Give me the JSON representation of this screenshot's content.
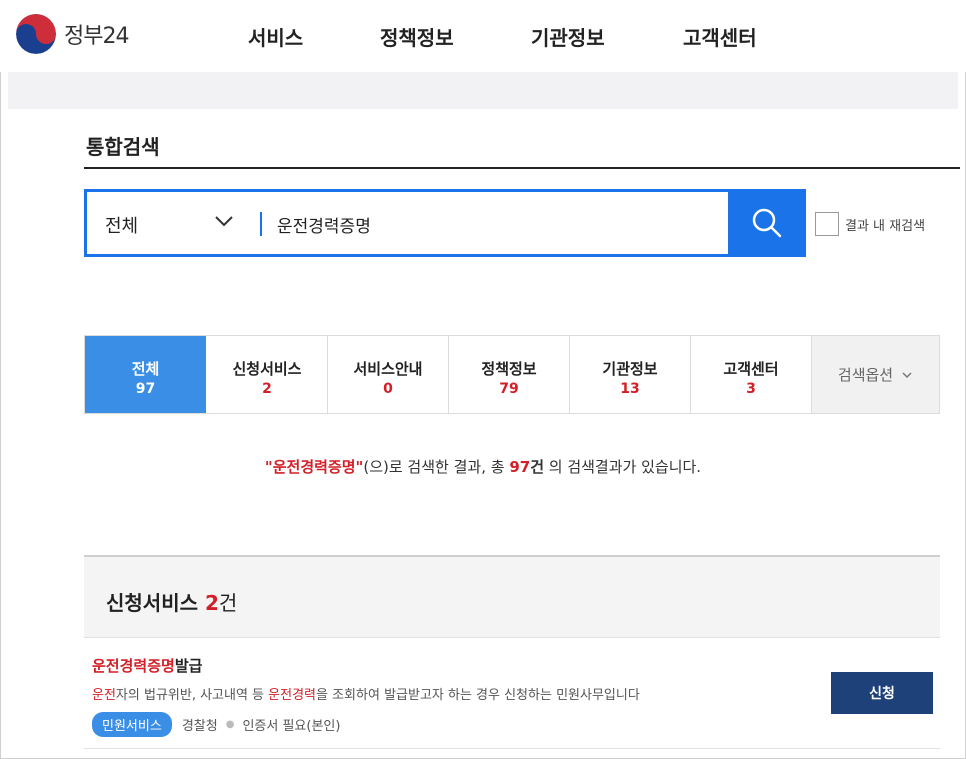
{
  "header": {
    "logo_text": "정부24",
    "nav": [
      "서비스",
      "정책정보",
      "기관정보",
      "고객센터"
    ]
  },
  "page": {
    "title": "통합검색"
  },
  "search": {
    "category": "전체",
    "query": "운전경력증명",
    "re_search_label": "결과 내 재검색"
  },
  "tabs": [
    {
      "name": "전체",
      "count": "97",
      "active": true
    },
    {
      "name": "신청서비스",
      "count": "2"
    },
    {
      "name": "서비스안내",
      "count": "0"
    },
    {
      "name": "정책정보",
      "count": "79"
    },
    {
      "name": "기관정보",
      "count": "13"
    },
    {
      "name": "고객센터",
      "count": "3"
    }
  ],
  "tab_option": "검색옵션",
  "summary": {
    "query_quoted": "\"운전경력증명\"",
    "mid": "(으)로 검색한 결과, 총 ",
    "total": "97",
    "unit": "건",
    "tail": " 의 검색결과가 있습니다."
  },
  "section": {
    "title": "신청서비스",
    "count": "2",
    "unit": "건"
  },
  "result": {
    "title_highlight": "운전경력증명",
    "title_rest": "발급",
    "desc": {
      "p1": "운전",
      "p2": "자의 법규위반, 사고내역 등 ",
      "p3": "운전경력",
      "p4": "을 조회하여 발급받고자 하는 경우 신청하는 민원사무입니다"
    },
    "badge": "민원서비스",
    "agency": "경찰청",
    "requirement": "인증서 필요(본인)",
    "button": "신청"
  },
  "colors": {
    "primary_blue": "#1a73e8",
    "tab_active": "#3a8ee6",
    "highlight_red": "#d31f27",
    "button_navy": "#1e4179"
  }
}
